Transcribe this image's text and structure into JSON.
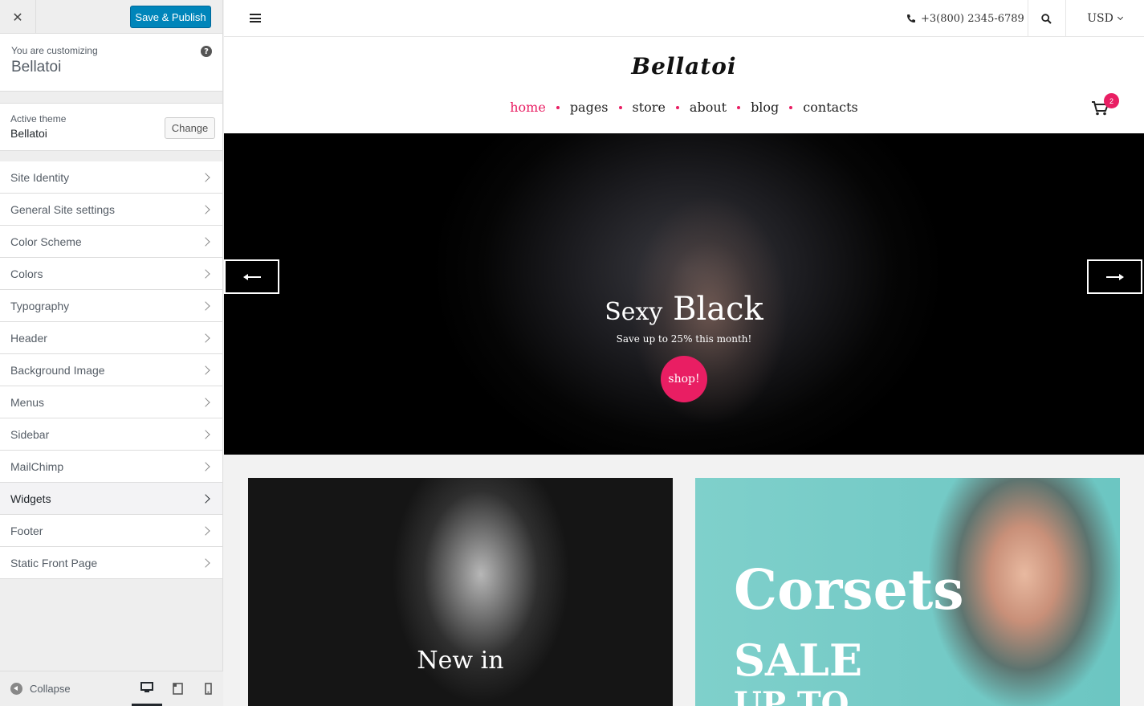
{
  "sidebar": {
    "save_label": "Save & Publish",
    "customizing_label": "You are customizing",
    "site_name": "Bellatoi",
    "active_theme_label": "Active theme",
    "theme_name": "Bellatoi",
    "change_label": "Change",
    "items": [
      {
        "label": "Site Identity"
      },
      {
        "label": "General Site settings"
      },
      {
        "label": "Color Scheme"
      },
      {
        "label": "Colors"
      },
      {
        "label": "Typography"
      },
      {
        "label": "Header"
      },
      {
        "label": "Background Image"
      },
      {
        "label": "Menus"
      },
      {
        "label": "Sidebar"
      },
      {
        "label": "MailChimp"
      },
      {
        "label": "Widgets"
      },
      {
        "label": "Footer"
      },
      {
        "label": "Static Front Page"
      }
    ],
    "collapse_label": "Collapse"
  },
  "preview": {
    "phone": "+3(800) 2345-6789",
    "currency": "USD",
    "logo": "Bellatoi",
    "nav": [
      {
        "label": "home"
      },
      {
        "label": "pages"
      },
      {
        "label": "store"
      },
      {
        "label": "about"
      },
      {
        "label": "blog"
      },
      {
        "label": "contacts"
      }
    ],
    "cart_count": "2",
    "hero": {
      "title_small": "Sexy",
      "title_big": "Black",
      "subtitle": "Save up to 25% this month!",
      "button": "shop!"
    },
    "card1_label": "New in",
    "card2_title": "Corsets",
    "card2_sale": "SALE",
    "card2_upto": "UP TO"
  },
  "colors": {
    "accent": "#e91e63",
    "wp_primary": "#0085ba"
  }
}
